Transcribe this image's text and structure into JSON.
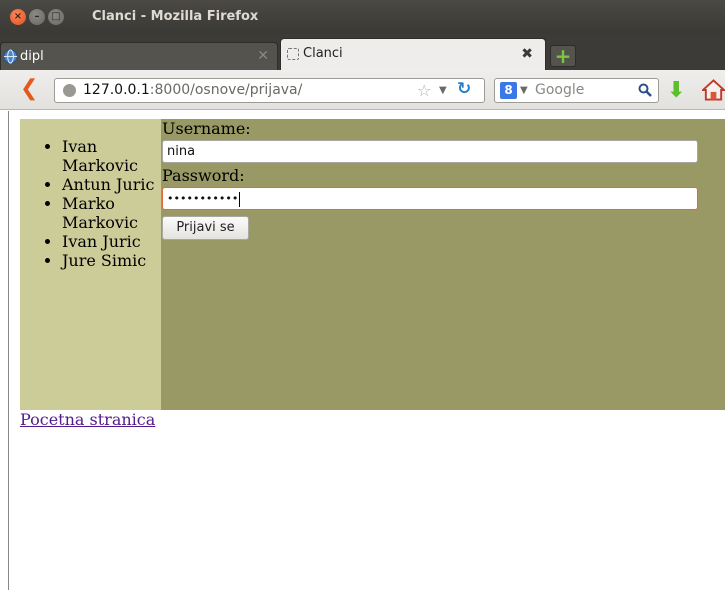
{
  "window": {
    "title": "Clanci - Mozilla Firefox"
  },
  "tabs": [
    {
      "label": "dipl"
    },
    {
      "label": "Clanci"
    }
  ],
  "navbar": {
    "url_host": "127.0.0.1",
    "url_path": ":8000/osnove/prijava/",
    "search_placeholder": "Google",
    "search_engine_badge": "8"
  },
  "sidebar": {
    "authors": [
      "Ivan Markovic",
      "Antun Juric",
      "Marko Markovic",
      "Ivan Juric",
      "Jure Simic"
    ]
  },
  "login_form": {
    "username_label": "Username:",
    "username_value": "nina",
    "password_label": "Password:",
    "password_masked": "•••••••••••",
    "submit_label": "Prijavi se"
  },
  "footer": {
    "home_link": "Pocetna stranica"
  },
  "colors": {
    "content_bg": "#999966",
    "sidebar_bg": "#cccc99",
    "visited_link": "#551a8b"
  }
}
